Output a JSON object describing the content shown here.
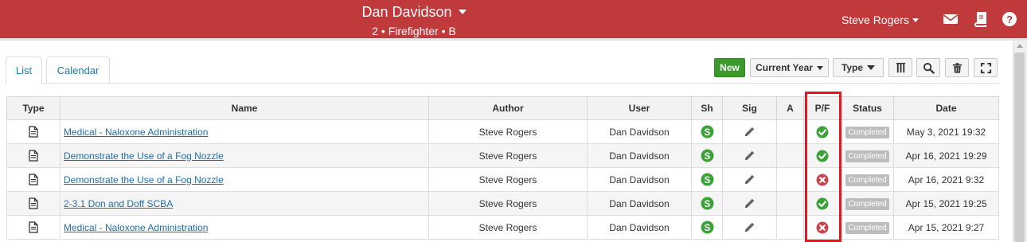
{
  "header": {
    "person_name": "Dan Davidson",
    "person_details": "2 • Firefighter • B",
    "user_name": "Steve Rogers",
    "icons": [
      "envelope-icon",
      "book-icon",
      "help-icon"
    ]
  },
  "tabs": [
    {
      "label": "List",
      "active": true
    },
    {
      "label": "Calendar",
      "active": false
    }
  ],
  "toolbar": {
    "new_label": "New",
    "year_filter": "Current Year",
    "type_filter": "Type",
    "icons": [
      "columns-icon",
      "search-icon",
      "trash-icon",
      "expand-icon"
    ]
  },
  "table": {
    "columns": [
      "Type",
      "Name",
      "Author",
      "User",
      "Sh",
      "Sig",
      "A",
      "P/F",
      "Status",
      "Date"
    ],
    "rows": [
      {
        "name": "Medical - Naloxone Administration",
        "author": "Steve Rogers",
        "user": "Dan Davidson",
        "pf": "pass",
        "status": "Completed",
        "date": "May 3, 2021 19:32"
      },
      {
        "name": "Demonstrate the Use of a Fog Nozzle",
        "author": "Steve Rogers",
        "user": "Dan Davidson",
        "pf": "pass",
        "status": "Completed",
        "date": "Apr 16, 2021 19:29"
      },
      {
        "name": "Demonstrate the Use of a Fog Nozzle",
        "author": "Steve Rogers",
        "user": "Dan Davidson",
        "pf": "fail",
        "status": "Completed",
        "date": "Apr 16, 2021 9:32"
      },
      {
        "name": "2-3.1 Don and Doff SCBA",
        "author": "Steve Rogers",
        "user": "Dan Davidson",
        "pf": "pass",
        "status": "Completed",
        "date": "Apr 15, 2021 19:25"
      },
      {
        "name": "Medical - Naloxone Administration",
        "author": "Steve Rogers",
        "user": "Dan Davidson",
        "pf": "fail",
        "status": "Completed",
        "date": "Apr 15, 2021 9:27"
      }
    ]
  },
  "colors": {
    "header_bg": "#c0393b",
    "new_button": "#3c9a2b",
    "pass": "#3aa236",
    "fail": "#c9434b",
    "highlight": "#e8161c",
    "link": "#1d6fb0"
  }
}
